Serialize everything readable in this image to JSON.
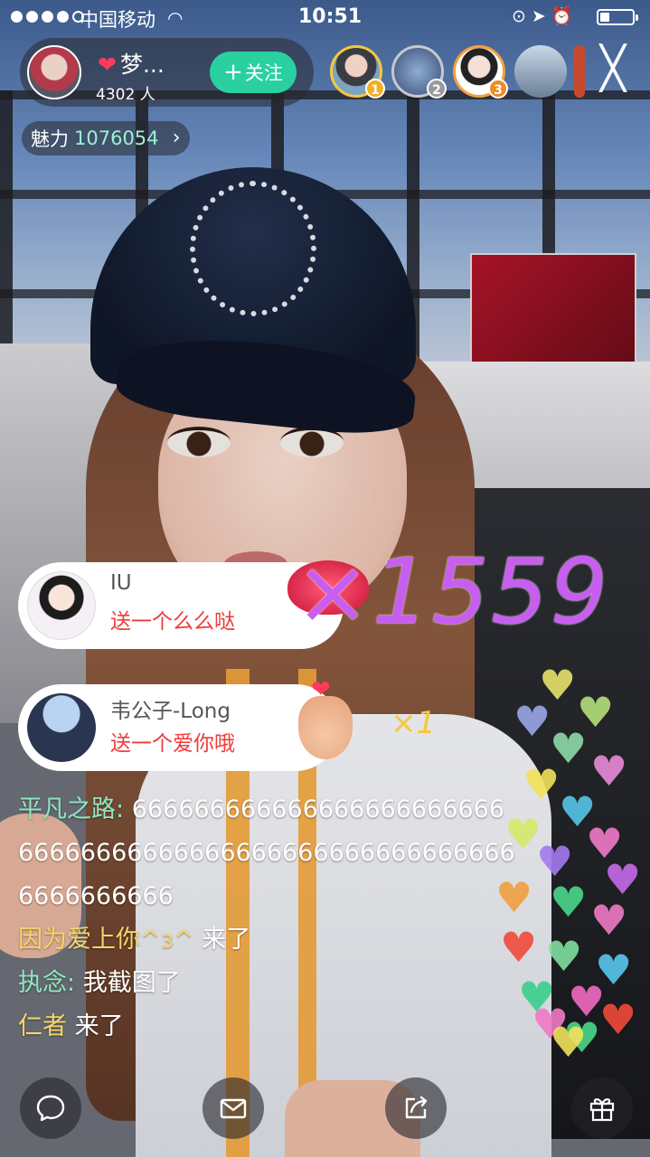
{
  "status_bar": {
    "carrier": "中国移动",
    "time": "10:51",
    "wifi_icon": "wifi-icon",
    "icons": [
      "orientation-lock-icon",
      "location-icon",
      "alarm-icon"
    ],
    "battery_level": 0.3
  },
  "host": {
    "name": "梦...",
    "viewers": "4302 人",
    "follow_label": "关注",
    "follow_icon": "+"
  },
  "charm": {
    "label": "魅力",
    "value": "1076054",
    "chevron": "›"
  },
  "audience": [
    {
      "rank": "1"
    },
    {
      "rank": "2"
    },
    {
      "rank": "3"
    },
    {
      "rank": ""
    }
  ],
  "close_glyph": "╳",
  "gifts": [
    {
      "user": "IU",
      "message": "送一个么么哒",
      "combo": "×1559",
      "gift_icon": "kiss-lips-icon"
    },
    {
      "user": "韦公子-Long",
      "message": "送一个爱你哦",
      "combo": "×1",
      "gift_icon": "finger-heart-icon"
    }
  ],
  "chat": [
    {
      "nick": "平凡之路:",
      "text": " 666666666666666666666666666666666666666666666666666666666666666666"
    },
    {
      "nick": "因为爱上你^з^",
      "text": " 来了"
    },
    {
      "nick": "执念:",
      "text": " 我截图了"
    },
    {
      "nick": "仁者",
      "text": " 来了"
    }
  ],
  "colors": {
    "follow_green": "#2ad0a0",
    "charm_value": "#9ef0d2",
    "gift_message_red": "#ef3b3b",
    "combo_purple": "#c85ef0",
    "combo_yellow": "#f6c83a"
  },
  "bottom_bar": [
    "chat-bubble-icon",
    "mail-icon",
    "share-icon",
    "gift-icon"
  ]
}
